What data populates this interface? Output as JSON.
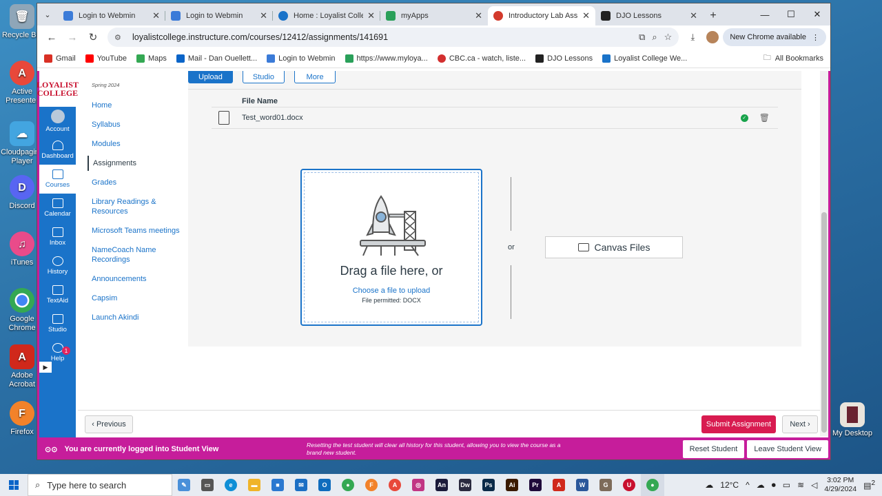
{
  "desktop": {
    "icons": [
      {
        "label": "Recycle Bin",
        "color": "#8fa6b8",
        "glyph": "🗑"
      },
      {
        "label": "Active Presenter",
        "color": "#e8483a",
        "glyph": "A"
      },
      {
        "label": "Cloudpaging Player",
        "color": "#43a5e0",
        "glyph": "☁"
      },
      {
        "label": "Discord",
        "color": "#5865f2",
        "glyph": "D"
      },
      {
        "label": "iTunes",
        "color": "#e94b8a",
        "glyph": "♫"
      },
      {
        "label": "Google Chrome",
        "color": "#34a853",
        "glyph": "●"
      },
      {
        "label": "Adobe Acrobat",
        "color": "#d0281b",
        "glyph": "A"
      },
      {
        "label": "Firefox",
        "color": "#f2822a",
        "glyph": "F"
      }
    ],
    "right_icon": {
      "label": "My Desktop"
    }
  },
  "browser": {
    "tabs": [
      {
        "label": "Login to Webmin",
        "color": "#3b7bd8"
      },
      {
        "label": "Login to Webmin",
        "color": "#3b7bd8"
      },
      {
        "label": "Home : Loyalist College",
        "color": "#1a73c9"
      },
      {
        "label": "myApps",
        "color": "#2aa05a"
      },
      {
        "label": "Introductory Lab Assignment",
        "color": "#d33a2c"
      },
      {
        "label": "DJO Lessons",
        "color": "#222222"
      }
    ],
    "active_tab_index": 4,
    "url": "loyalistcollege.instructure.com/courses/12412/assignments/141691",
    "chrome_available": "New Chrome available",
    "bookmarks": [
      {
        "label": "Gmail",
        "color": "#d93025"
      },
      {
        "label": "YouTube",
        "color": "#ff0000"
      },
      {
        "label": "Maps",
        "color": "#34a853"
      },
      {
        "label": "Mail - Dan Ouellett...",
        "color": "#0a64c8"
      },
      {
        "label": "Login to Webmin",
        "color": "#3b7bd8"
      },
      {
        "label": "https://www.myloya...",
        "color": "#2aa05a"
      },
      {
        "label": "CBC.ca - watch, liste...",
        "color": "#d32f2f"
      },
      {
        "label": "DJO Lessons",
        "color": "#222222"
      },
      {
        "label": "Loyalist College We...",
        "color": "#1a73c9"
      }
    ],
    "all_bookmarks": "All Bookmarks"
  },
  "canvas": {
    "logo_line1": "LOYALIST",
    "logo_line2": "COLLEGE",
    "global_nav": [
      "Account",
      "Dashboard",
      "Courses",
      "Calendar",
      "Inbox",
      "History",
      "TextAid",
      "Studio",
      "Help"
    ],
    "help_badge": "1",
    "term": "Spring 2024",
    "course_nav": [
      "Home",
      "Syllabus",
      "Modules",
      "Assignments",
      "Grades",
      "Library Readings & Resources",
      "Microsoft Teams meetings",
      "NameCoach Name Recordings",
      "Announcements",
      "Capsim",
      "Launch Akindi"
    ],
    "active_course_nav": "Assignments",
    "submission_tabs": [
      "Upload",
      "Studio",
      "More"
    ],
    "file_header": "File Name",
    "file_name": "Test_word01.docx",
    "drag_text": "Drag a file here, or",
    "choose_text": "Choose a file to upload",
    "permit_text": "File permitted: DOCX",
    "or_text": "or",
    "canvas_files": "Canvas Files",
    "previous": "Previous",
    "submit": "Submit Assignment",
    "next": "Next",
    "student_view_text": "You are currently logged into Student View",
    "student_view_msg": "Resetting the test student will clear all history for this student, allowing you to view the course as a brand new student.",
    "reset_btn": "Reset Student",
    "leave_btn": "Leave Student View",
    "accent": "#1a73c9",
    "student_view_color": "#c61d9b",
    "submit_color": "#d81b50"
  },
  "taskbar": {
    "search_placeholder": "Type here to search",
    "apps": [
      {
        "name": "whiteboard",
        "color": "#4a90d9",
        "glyph": "✎"
      },
      {
        "name": "task-view",
        "color": "#555555",
        "glyph": "▭"
      },
      {
        "name": "edge",
        "color": "#0f8fd6",
        "glyph": "e"
      },
      {
        "name": "file-explorer",
        "color": "#f0b429",
        "glyph": "▬"
      },
      {
        "name": "store",
        "color": "#2b78d0",
        "glyph": "■"
      },
      {
        "name": "mail",
        "color": "#1c6fc4",
        "glyph": "✉"
      },
      {
        "name": "outlook",
        "color": "#0f6cbd",
        "glyph": "O"
      },
      {
        "name": "chrome",
        "color": "#34a853",
        "glyph": "●"
      },
      {
        "name": "firefox",
        "color": "#f2822a",
        "glyph": "F"
      },
      {
        "name": "active-presenter",
        "color": "#e8483a",
        "glyph": "A"
      },
      {
        "name": "instagram",
        "color": "#c13584",
        "glyph": "◎"
      },
      {
        "name": "animate",
        "color": "#1a1a3a",
        "glyph": "An"
      },
      {
        "name": "dreamweaver",
        "color": "#2a2a3f",
        "glyph": "Dw"
      },
      {
        "name": "photoshop",
        "color": "#0b2a48",
        "glyph": "Ps"
      },
      {
        "name": "illustrator",
        "color": "#3a1a00",
        "glyph": "Ai"
      },
      {
        "name": "premiere",
        "color": "#1f0a3a",
        "glyph": "Pr"
      },
      {
        "name": "acrobat",
        "color": "#d0281b",
        "glyph": "A"
      },
      {
        "name": "word",
        "color": "#2b579a",
        "glyph": "W"
      },
      {
        "name": "gimp",
        "color": "#7d6b5a",
        "glyph": "G"
      },
      {
        "name": "security",
        "color": "#c8102e",
        "glyph": "U"
      },
      {
        "name": "chrome-active",
        "color": "#34a853",
        "glyph": "●"
      }
    ],
    "temperature": "12°C",
    "time": "3:02 PM",
    "date": "4/29/2024",
    "notifications": "2"
  }
}
